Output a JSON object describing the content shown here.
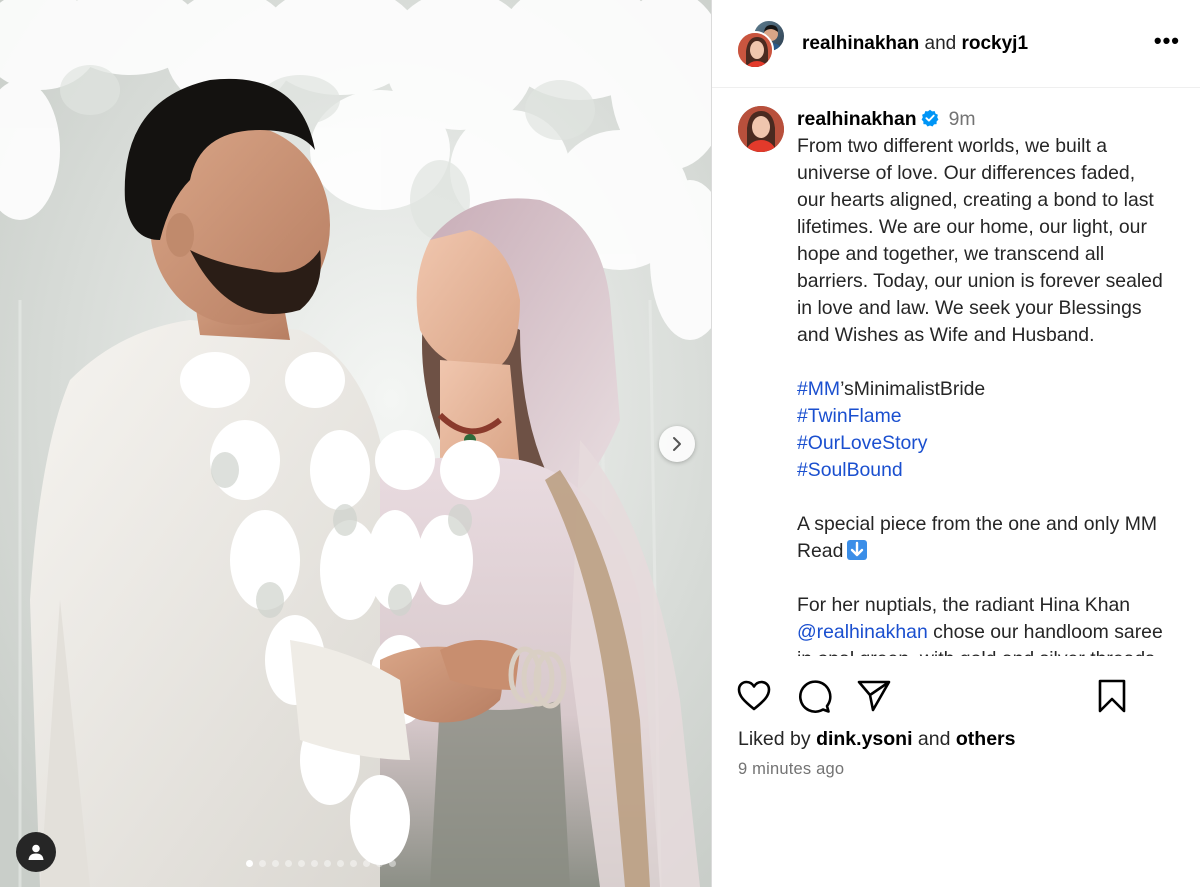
{
  "header": {
    "user1": "realhinakhan",
    "and_text": "and",
    "user2": "rockyj1",
    "more_label": "•••"
  },
  "caption": {
    "username": "realhinakhan",
    "time": "9m",
    "paragraph_lines": [
      "From two different worlds, we built a",
      "universe of love. Our differences faded,",
      "our hearts aligned, creating a bond to last",
      "lifetimes. We are our home, our light, our",
      "hope and together, we transcend all",
      "barriers. Today, our union is forever sealed",
      "in love and law. We seek your Blessings",
      "and Wishes as Wife and Husband."
    ],
    "hashtag1_tag": "#MM",
    "hashtag1_rest": "’sMinimalistBride",
    "hashtag2": "#TwinFlame",
    "hashtag3": "#OurLoveStory",
    "hashtag4": "#SoulBound",
    "special_line1": "A special piece from the one and only MM",
    "special_line2": "Read",
    "nuptials_line1": "For her nuptials, the radiant Hina Khan",
    "mention": "@realhinakhan",
    "nuptials_line2_rest": " chose our handloom saree",
    "nuptials_line3": "in opal green, with gold and silver threads"
  },
  "engagement": {
    "liked_by_prefix": "Liked by ",
    "liked_by_user": "dink.ysoni",
    "liked_by_mid": " and ",
    "liked_by_others": "others",
    "time_ago": "9 minutes ago"
  },
  "carousel": {
    "total_dots": 12,
    "active_dot": 1
  },
  "colors": {
    "link": "#1a4fcf",
    "verified": "#0095f6",
    "muted": "#737373"
  }
}
